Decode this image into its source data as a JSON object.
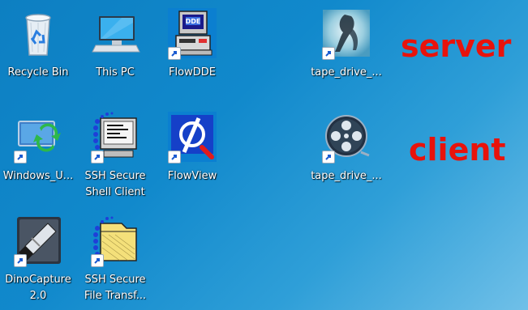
{
  "desktop": {
    "icons": [
      {
        "label_lines": [
          "Recycle Bin"
        ],
        "icon": "recycle-bin-icon",
        "shortcut": false
      },
      {
        "label_lines": [
          "This PC"
        ],
        "icon": "computer-icon",
        "shortcut": false
      },
      {
        "label_lines": [
          "FlowDDE"
        ],
        "icon": "flowdde-icon",
        "icon_text": "DDE",
        "shortcut": true
      },
      {
        "label_lines": [
          "tape_drive_..."
        ],
        "icon": "tape-drive-server-thumbnail-icon",
        "shortcut": true
      },
      {
        "label_lines": [
          "Windows_U..."
        ],
        "icon": "windows-update-icon",
        "shortcut": true
      },
      {
        "label_lines": [
          "SSH Secure",
          "Shell Client"
        ],
        "icon": "ssh-shell-client-icon",
        "shortcut": true
      },
      {
        "label_lines": [
          "FlowView"
        ],
        "icon": "flowview-icon",
        "shortcut": true
      },
      {
        "label_lines": [
          "tape_drive_..."
        ],
        "icon": "film-reel-icon",
        "shortcut": true
      },
      {
        "label_lines": [
          "DinoCapture",
          "2.0"
        ],
        "icon": "dinocapture-icon",
        "shortcut": true
      },
      {
        "label_lines": [
          "SSH Secure",
          "File Transf..."
        ],
        "icon": "ssh-file-transfer-icon",
        "shortcut": true
      }
    ]
  },
  "annotations": {
    "server": "server",
    "client": "client",
    "color": "#e8130c"
  }
}
